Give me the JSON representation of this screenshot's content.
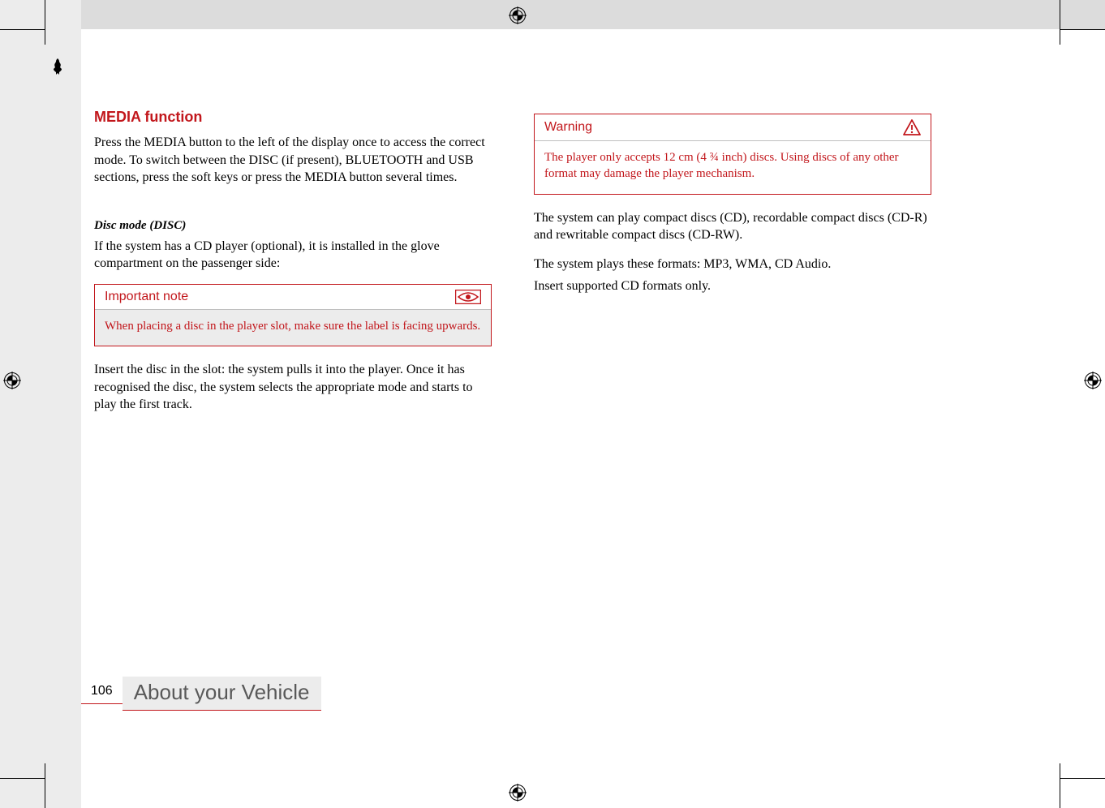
{
  "heading": "MEDIA function",
  "para1": "Press the MEDIA button to the left of the display once to access the correct mode. To switch between the DISC (if present), BLUETOOTH and USB sections, press the soft keys or press the MEDIA button several times.",
  "subheading": "Disc mode (DISC)",
  "para2": "If the system has a CD player (optional), it is installed in the glove compartment on the passenger side:",
  "important_note": {
    "title": "Important note",
    "body": "When placing a disc in the player slot, make sure the label is facing upwards."
  },
  "para3": "Insert the disc in the slot: the system pulls it into the player. Once it has recognised the disc, the system selects the appropriate mode and starts to play the first track.",
  "warning": {
    "title": "Warning",
    "body": "The player only accepts 12 cm (4 ¾ inch) discs. Using discs of any other format may damage the player mechanism."
  },
  "para4": "The system can play compact discs (CD), recordable compact discs (CD-R) and rewritable compact discs (CD-RW).",
  "para5": "The system plays these formats: MP3, WMA, CD Audio.",
  "para6": "Insert supported CD formats only.",
  "page_number": "106",
  "section_title": "About your Vehicle"
}
